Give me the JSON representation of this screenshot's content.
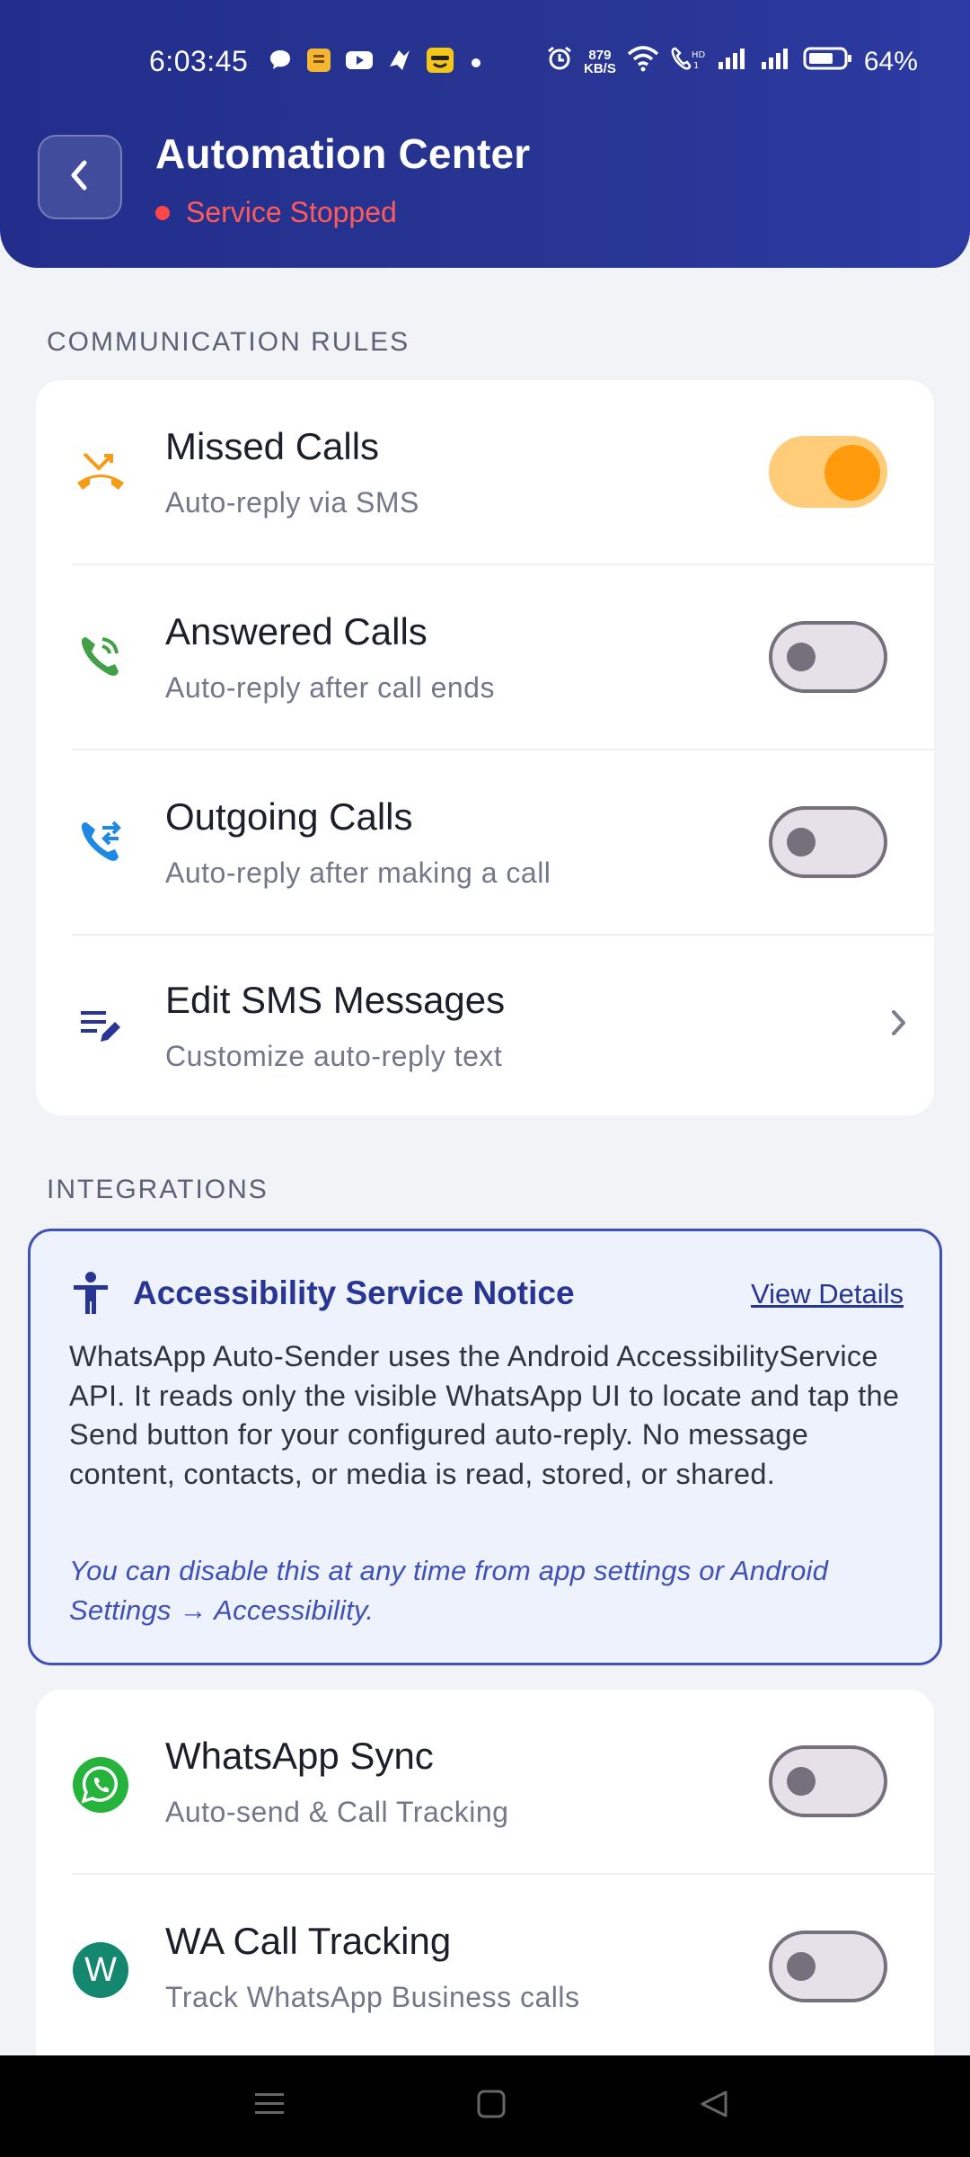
{
  "status_bar": {
    "time": "6:03:45",
    "net_speed_value": "879",
    "net_speed_unit": "KB/S",
    "battery": "64%",
    "left_icons": [
      "chat-bubble-icon",
      "note-app-icon",
      "youtube-icon",
      "bird-app-icon",
      "emoji-app-icon",
      "dot-icon"
    ],
    "right_icons": [
      "alarm-icon",
      "wifi-icon",
      "volte-icon",
      "signal-icon",
      "signal-icon",
      "battery-icon"
    ]
  },
  "header": {
    "title": "Automation Center",
    "service_status": "Service Stopped",
    "status_color": "#ff4747"
  },
  "communication": {
    "label": "COMMUNICATION RULES",
    "rows": [
      {
        "title": "Missed Calls",
        "subtitle": "Auto-reply via SMS",
        "enabled": true,
        "icon": "missed-call-icon"
      },
      {
        "title": "Answered Calls",
        "subtitle": "Auto-reply after call ends",
        "enabled": false,
        "icon": "answered-call-icon"
      },
      {
        "title": "Outgoing Calls",
        "subtitle": "Auto-reply after making a call",
        "enabled": false,
        "icon": "outgoing-call-icon"
      },
      {
        "title": "Edit SMS Messages",
        "subtitle": "Customize auto-reply text",
        "icon": "edit-note-icon"
      }
    ]
  },
  "integrations": {
    "label": "INTEGRATIONS",
    "notice": {
      "title": "Accessibility Service Notice",
      "link": "View Details",
      "body": "WhatsApp Auto-Sender uses the Android AccessibilityService API. It reads only the visible WhatsApp UI to locate and tap the Send button for your configured auto-reply. No message content, contacts, or media is read, stored, or shared.",
      "note": "You can disable this at any time from app settings or Android Settings → Accessibility."
    },
    "rows": [
      {
        "title": "WhatsApp Sync",
        "subtitle": "Auto-send & Call Tracking",
        "enabled": false,
        "icon": "whatsapp-icon"
      },
      {
        "title": "WA Call Tracking",
        "subtitle": "Track WhatsApp Business calls",
        "enabled": false,
        "icon": "wa-business-icon",
        "icon_letter": "W"
      }
    ]
  },
  "colors": {
    "header": "#283593",
    "accent_orange": "#ff9b0c",
    "notice_border": "#3f51b5",
    "whatsapp_green": "#25b33b",
    "wa_business_teal": "#14876e"
  }
}
